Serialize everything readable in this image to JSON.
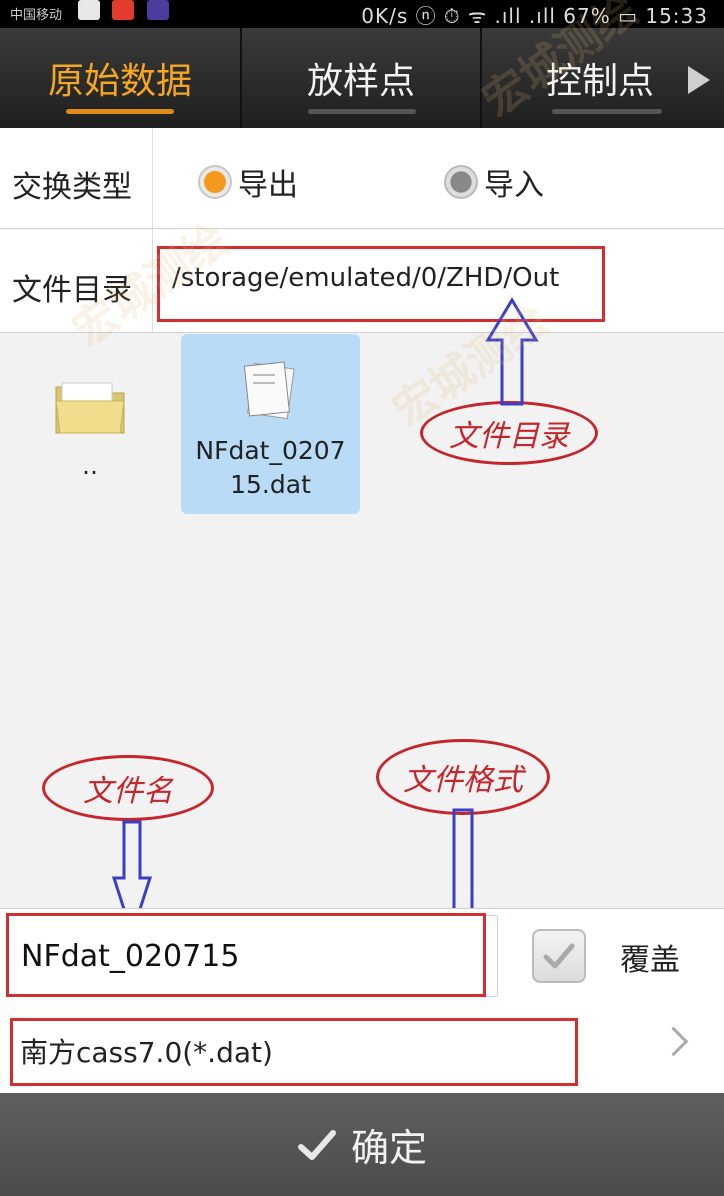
{
  "status_bar": {
    "carrier": "中国移动",
    "right_text": "0K/s  ⓝ ⏱ ᯤ  .ıll  .ıll 67%  ▭  15:33"
  },
  "tabs": [
    {
      "label": "原始数据",
      "active": true
    },
    {
      "label": "放样点",
      "active": false
    },
    {
      "label": "控制点",
      "active": false
    }
  ],
  "exchange": {
    "label": "交换类型",
    "options": [
      {
        "label": "导出",
        "selected": true
      },
      {
        "label": "导入",
        "selected": false
      }
    ]
  },
  "directory": {
    "label": "文件目录",
    "path": "/storage/emulated/0/ZHD/Out"
  },
  "files": [
    {
      "name": "..",
      "type": "folder",
      "selected": false
    },
    {
      "name_line1": "NFdat_0207",
      "name_line2": "15.dat",
      "type": "file",
      "selected": true
    }
  ],
  "annotations": {
    "directory": "文件目录",
    "filename": "文件名",
    "format": "文件格式"
  },
  "filename_input": {
    "value": "NFdat_020715"
  },
  "overwrite": {
    "label": "覆盖",
    "checked": true
  },
  "format": {
    "value": "南方cass7.0(*.dat)"
  },
  "confirm_button": {
    "label": "确定"
  },
  "watermark": "宏城测绘",
  "colors": {
    "accent": "#f5a623",
    "annotation": "#c4262c",
    "arrow": "#3a3fc4",
    "selected": "#b9dbf6"
  }
}
